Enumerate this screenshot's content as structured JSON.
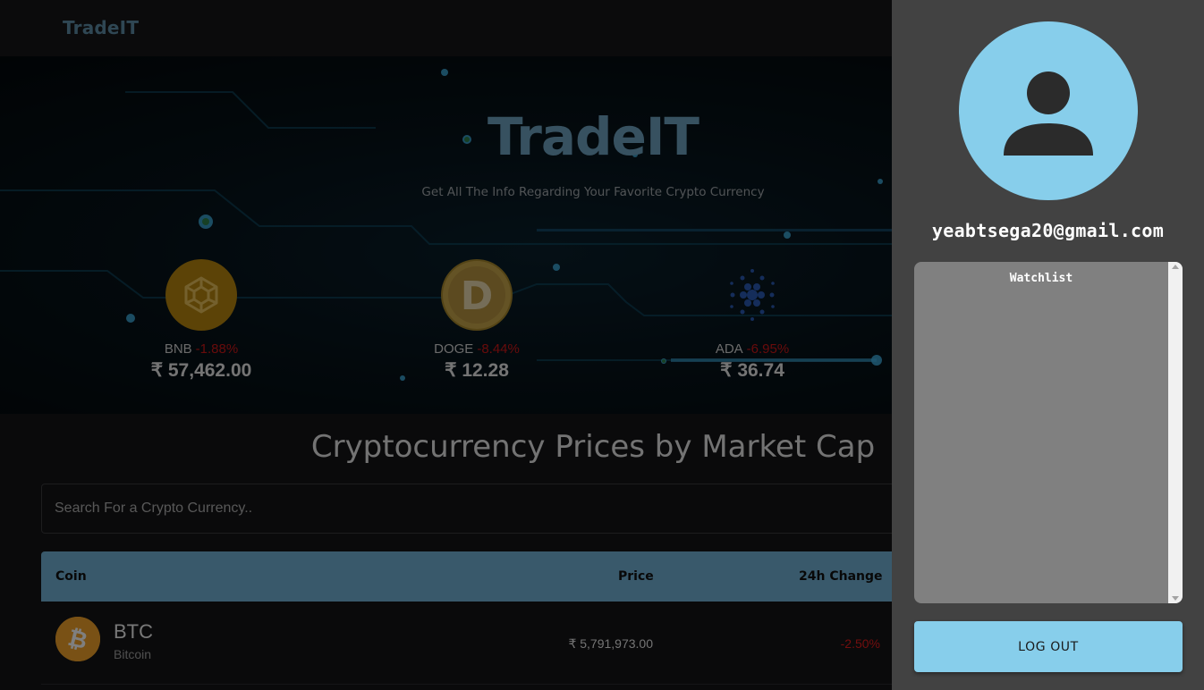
{
  "app": {
    "brand": "TradeIT"
  },
  "hero": {
    "title": "TradeIT",
    "subtitle": "Get All The Info Regarding Your Favorite Crypto Currency",
    "coins": [
      {
        "symbol": "BNB",
        "change": "-1.88%",
        "price": "₹ 57,462.00",
        "logo_icon": "bnb-logo-icon",
        "logo_color": "#b8870e"
      },
      {
        "symbol": "DOGE",
        "change": "-8.44%",
        "price": "₹ 12.28",
        "logo_icon": "doge-logo-icon",
        "logo_color": "#a8892c"
      },
      {
        "symbol": "ADA",
        "change": "-6.95%",
        "price": "₹ 36.74",
        "logo_icon": "ada-logo-icon",
        "logo_color": "#2a5bb5"
      }
    ]
  },
  "main": {
    "section_title": "Cryptocurrency Prices by Market Cap",
    "search_placeholder": "Search For a Crypto Currency..",
    "table": {
      "headers": {
        "coin": "Coin",
        "price": "Price",
        "change": "24h Change"
      },
      "rows": [
        {
          "symbol": "BTC",
          "name": "Bitcoin",
          "price": "₹ 5,791,973.00",
          "change": "-2.50%",
          "logo_icon": "btc-logo-icon"
        }
      ]
    }
  },
  "drawer": {
    "avatar_icon": "user-avatar-icon",
    "email": "yeabtsega20@gmail.com",
    "watchlist_title": "Watchlist",
    "logout_label": "LOG OUT"
  },
  "colors": {
    "accent": "#87ceeb",
    "brand": "#5f8ea8",
    "negative": "#e51c1c",
    "drawer_bg": "#424242",
    "watchlist_bg": "#808080"
  }
}
